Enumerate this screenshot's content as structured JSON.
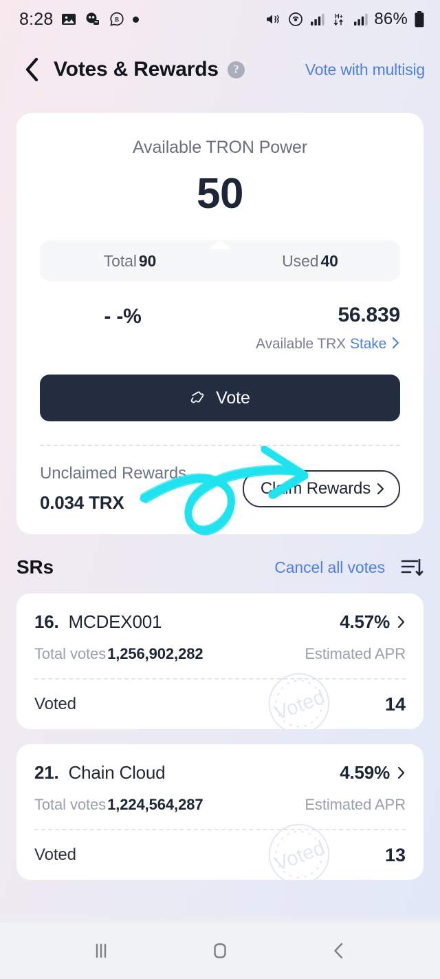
{
  "status_bar": {
    "time": "8:28",
    "left_icons": [
      "image-icon",
      "messenger-icon",
      "brave-icon",
      "dot-icon"
    ],
    "right_icons": [
      "mute-vibrate-icon",
      "hotspot-icon",
      "signal-icon",
      "hspa-plus-icon",
      "signal-icon"
    ],
    "battery_text": "86%",
    "battery_icon": "battery-icon"
  },
  "header": {
    "back_icon": "back-chevron-icon",
    "title": "Votes & Rewards",
    "help_icon": "help-circle-icon",
    "help_glyph": "?",
    "multisig_link": "Vote with multisig"
  },
  "power_card": {
    "label": "Available TRON Power",
    "value": "50",
    "pill": [
      {
        "label": "Total",
        "value": "90"
      },
      {
        "label": "Used",
        "value": "40"
      }
    ],
    "percent": "- -%",
    "trx_amount": "56.839",
    "trx_label": "Available TRX",
    "stake_link": "Stake",
    "stake_chevron": "chevron-right-icon",
    "vote_button": "Vote",
    "vote_icon": "ticket-icon",
    "unclaimed_label": "Unclaimed Rewards",
    "unclaimed_value": "0.034 TRX",
    "claim_button": "Claim Rewards",
    "claim_chevron": "chevron-right-icon"
  },
  "srs": {
    "title": "SRs",
    "cancel_link": "Cancel all votes",
    "sort_icon": "sort-descending-icon",
    "items": [
      {
        "rank": "16.",
        "name": "MCDEX001",
        "apr": "4.57%",
        "chevron": "chevron-right-icon",
        "votes_label": "Total votes",
        "votes_value": "1,256,902,282",
        "apr_label": "Estimated APR",
        "voted_label": "Voted",
        "voted_count": "14",
        "stamp_text": "Voted"
      },
      {
        "rank": "21.",
        "name": "Chain Cloud",
        "apr": "4.59%",
        "chevron": "chevron-right-icon",
        "votes_label": "Total votes",
        "votes_value": "1,224,564,287",
        "apr_label": "Estimated APR",
        "voted_label": "Voted",
        "voted_count": "13",
        "stamp_text": "Voted"
      }
    ]
  },
  "annotation": {
    "type": "hand-drawn-arrow",
    "color": "#1fe3ee",
    "points_to": "Claim Rewards"
  },
  "nav_bar": {
    "recents_icon": "recents-icon",
    "home_icon": "home-icon",
    "back_icon": "back-chevron-icon"
  },
  "colors": {
    "accent_blue": "#4e7fe0",
    "dark": "#242c40",
    "muted": "#9aa1ae",
    "highlighter": "#1fe3ee"
  }
}
